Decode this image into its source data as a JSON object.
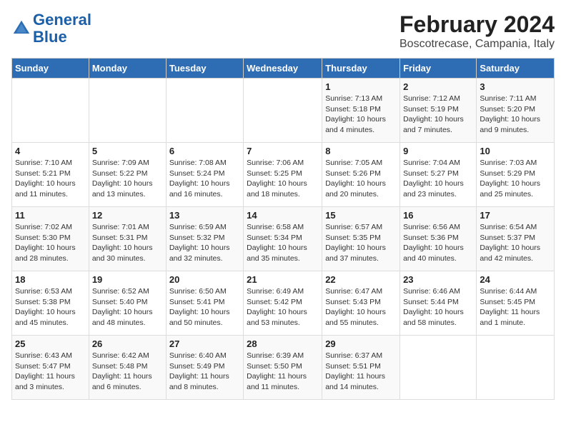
{
  "header": {
    "logo_line1": "General",
    "logo_line2": "Blue",
    "main_title": "February 2024",
    "subtitle": "Boscotrecase, Campania, Italy"
  },
  "weekdays": [
    "Sunday",
    "Monday",
    "Tuesday",
    "Wednesday",
    "Thursday",
    "Friday",
    "Saturday"
  ],
  "weeks": [
    [
      {
        "day": "",
        "info": ""
      },
      {
        "day": "",
        "info": ""
      },
      {
        "day": "",
        "info": ""
      },
      {
        "day": "",
        "info": ""
      },
      {
        "day": "1",
        "info": "Sunrise: 7:13 AM\nSunset: 5:18 PM\nDaylight: 10 hours\nand 4 minutes."
      },
      {
        "day": "2",
        "info": "Sunrise: 7:12 AM\nSunset: 5:19 PM\nDaylight: 10 hours\nand 7 minutes."
      },
      {
        "day": "3",
        "info": "Sunrise: 7:11 AM\nSunset: 5:20 PM\nDaylight: 10 hours\nand 9 minutes."
      }
    ],
    [
      {
        "day": "4",
        "info": "Sunrise: 7:10 AM\nSunset: 5:21 PM\nDaylight: 10 hours\nand 11 minutes."
      },
      {
        "day": "5",
        "info": "Sunrise: 7:09 AM\nSunset: 5:22 PM\nDaylight: 10 hours\nand 13 minutes."
      },
      {
        "day": "6",
        "info": "Sunrise: 7:08 AM\nSunset: 5:24 PM\nDaylight: 10 hours\nand 16 minutes."
      },
      {
        "day": "7",
        "info": "Sunrise: 7:06 AM\nSunset: 5:25 PM\nDaylight: 10 hours\nand 18 minutes."
      },
      {
        "day": "8",
        "info": "Sunrise: 7:05 AM\nSunset: 5:26 PM\nDaylight: 10 hours\nand 20 minutes."
      },
      {
        "day": "9",
        "info": "Sunrise: 7:04 AM\nSunset: 5:27 PM\nDaylight: 10 hours\nand 23 minutes."
      },
      {
        "day": "10",
        "info": "Sunrise: 7:03 AM\nSunset: 5:29 PM\nDaylight: 10 hours\nand 25 minutes."
      }
    ],
    [
      {
        "day": "11",
        "info": "Sunrise: 7:02 AM\nSunset: 5:30 PM\nDaylight: 10 hours\nand 28 minutes."
      },
      {
        "day": "12",
        "info": "Sunrise: 7:01 AM\nSunset: 5:31 PM\nDaylight: 10 hours\nand 30 minutes."
      },
      {
        "day": "13",
        "info": "Sunrise: 6:59 AM\nSunset: 5:32 PM\nDaylight: 10 hours\nand 32 minutes."
      },
      {
        "day": "14",
        "info": "Sunrise: 6:58 AM\nSunset: 5:34 PM\nDaylight: 10 hours\nand 35 minutes."
      },
      {
        "day": "15",
        "info": "Sunrise: 6:57 AM\nSunset: 5:35 PM\nDaylight: 10 hours\nand 37 minutes."
      },
      {
        "day": "16",
        "info": "Sunrise: 6:56 AM\nSunset: 5:36 PM\nDaylight: 10 hours\nand 40 minutes."
      },
      {
        "day": "17",
        "info": "Sunrise: 6:54 AM\nSunset: 5:37 PM\nDaylight: 10 hours\nand 42 minutes."
      }
    ],
    [
      {
        "day": "18",
        "info": "Sunrise: 6:53 AM\nSunset: 5:38 PM\nDaylight: 10 hours\nand 45 minutes."
      },
      {
        "day": "19",
        "info": "Sunrise: 6:52 AM\nSunset: 5:40 PM\nDaylight: 10 hours\nand 48 minutes."
      },
      {
        "day": "20",
        "info": "Sunrise: 6:50 AM\nSunset: 5:41 PM\nDaylight: 10 hours\nand 50 minutes."
      },
      {
        "day": "21",
        "info": "Sunrise: 6:49 AM\nSunset: 5:42 PM\nDaylight: 10 hours\nand 53 minutes."
      },
      {
        "day": "22",
        "info": "Sunrise: 6:47 AM\nSunset: 5:43 PM\nDaylight: 10 hours\nand 55 minutes."
      },
      {
        "day": "23",
        "info": "Sunrise: 6:46 AM\nSunset: 5:44 PM\nDaylight: 10 hours\nand 58 minutes."
      },
      {
        "day": "24",
        "info": "Sunrise: 6:44 AM\nSunset: 5:45 PM\nDaylight: 11 hours\nand 1 minute."
      }
    ],
    [
      {
        "day": "25",
        "info": "Sunrise: 6:43 AM\nSunset: 5:47 PM\nDaylight: 11 hours\nand 3 minutes."
      },
      {
        "day": "26",
        "info": "Sunrise: 6:42 AM\nSunset: 5:48 PM\nDaylight: 11 hours\nand 6 minutes."
      },
      {
        "day": "27",
        "info": "Sunrise: 6:40 AM\nSunset: 5:49 PM\nDaylight: 11 hours\nand 8 minutes."
      },
      {
        "day": "28",
        "info": "Sunrise: 6:39 AM\nSunset: 5:50 PM\nDaylight: 11 hours\nand 11 minutes."
      },
      {
        "day": "29",
        "info": "Sunrise: 6:37 AM\nSunset: 5:51 PM\nDaylight: 11 hours\nand 14 minutes."
      },
      {
        "day": "",
        "info": ""
      },
      {
        "day": "",
        "info": ""
      }
    ]
  ]
}
